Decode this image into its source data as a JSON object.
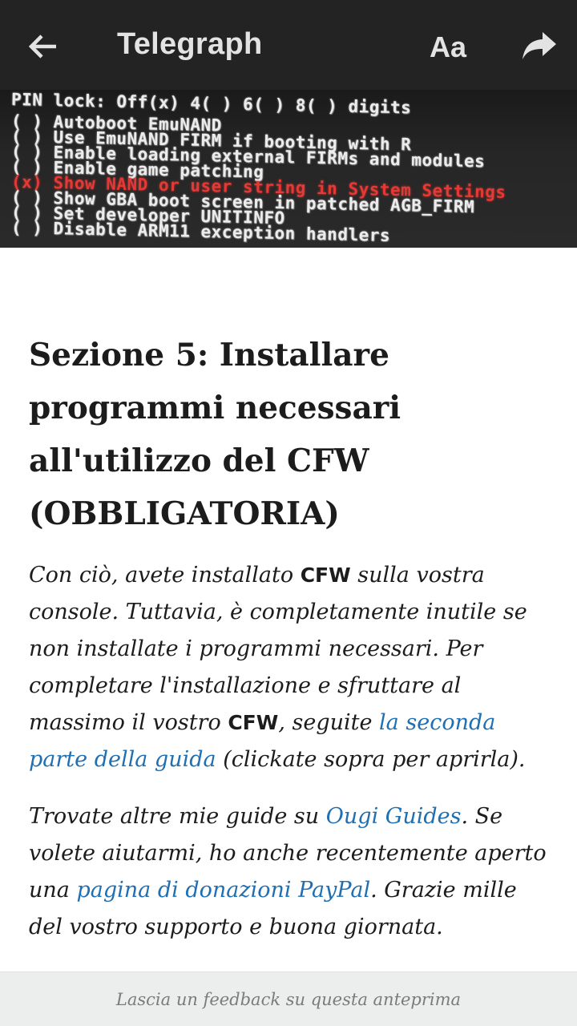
{
  "topbar": {
    "title": "Telegraph",
    "font_size_label": "Aa",
    "back_icon": "arrow-left-icon",
    "share_icon": "share-arrow-icon"
  },
  "hero_image": {
    "lines": [
      "PIN lock: Off(x) 4( ) 6( ) 8( ) digits",
      "( ) Autoboot EmuNAND",
      "( ) Use EmuNAND FIRM if booting with R",
      "( ) Enable loading external FIRMs and modules",
      "( ) Enable game patching",
      "(x) Show NAND or user string in System Settings",
      "( ) Show GBA boot screen in patched AGB_FIRM",
      "( ) Set developer UNITINFO",
      "( ) Disable ARM11 exception handlers"
    ],
    "highlight_color": "#e53935"
  },
  "article": {
    "heading": "Sezione 5: Installare programmi necessari all'utilizzo del CFW (OBBLIGATORIA)",
    "p1": {
      "t1": "Con ciò, avete installato ",
      "b1": "CFW",
      "t2": " sulla vostra console. Tuttavia, è completamente inutile se non installate i programmi necessari. Per completare l'installazione e sfruttare al massimo il vostro ",
      "b2": "CFW",
      "t3": ", seguite ",
      "link": "la seconda parte della guida",
      "t4": " (clickate sopra per aprirla)."
    },
    "p2": {
      "t1": "Trovate altre mie guide su ",
      "link1": "Ougi Guides",
      "t2": ". Se volete aiutarmi, ho anche recentemente aperto una ",
      "link2": "pagina di donazioni PayPal",
      "t3": ". Grazie mille del vostro supporto e buona giornata."
    }
  },
  "feedback": {
    "label": "Lascia un feedback su questa anteprima"
  }
}
